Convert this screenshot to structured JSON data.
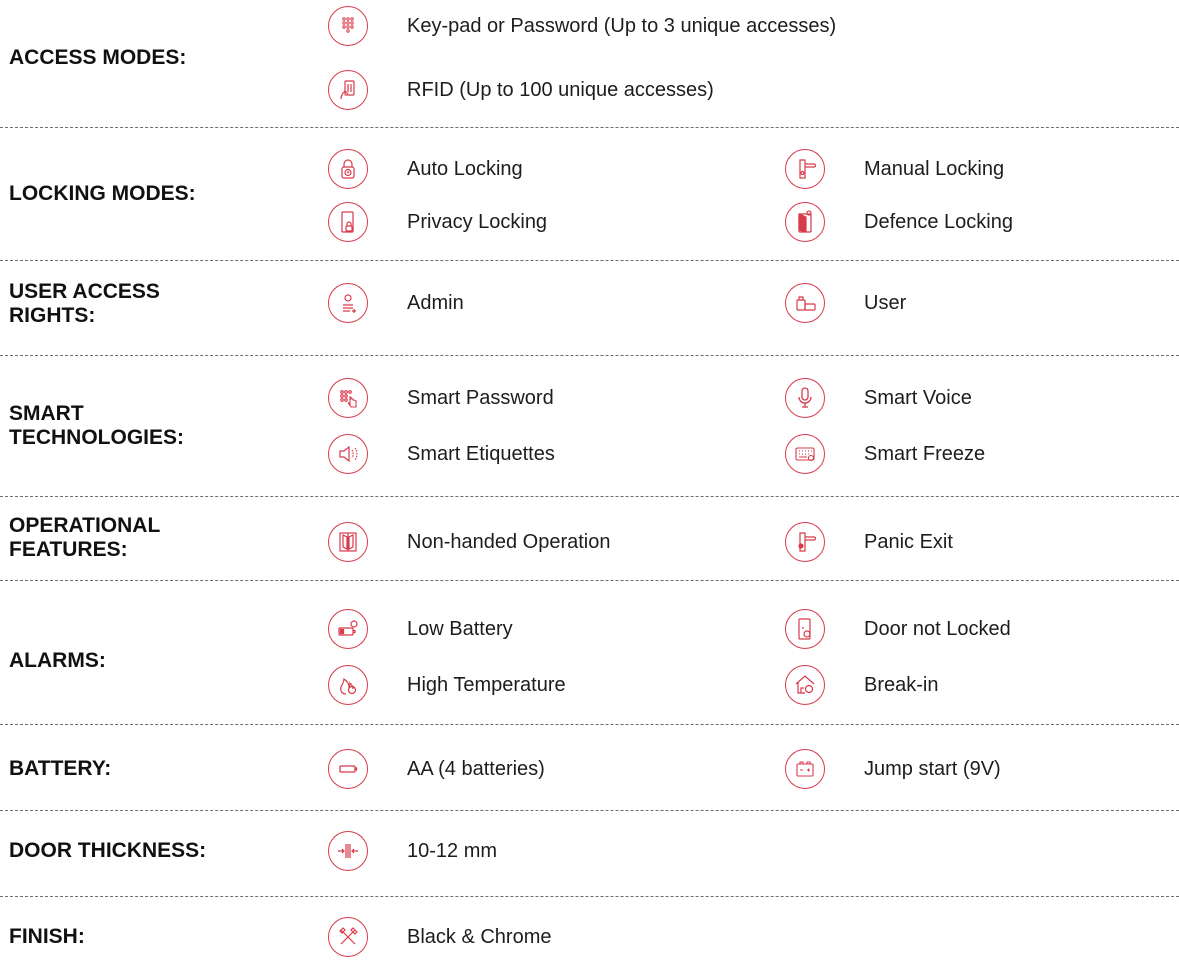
{
  "accent_color": "#d83a4a",
  "sections": [
    {
      "title_lines": [
        "ACCESS MODES:"
      ],
      "items": [
        {
          "icon": "keypad-icon",
          "text": "Key-pad or Password (Up to 3 unique accesses)"
        },
        {
          "icon": "rfid-card-icon",
          "text": "RFID (Up to 100 unique accesses)"
        }
      ]
    },
    {
      "title_lines": [
        "LOCKING MODES:"
      ],
      "items": [
        {
          "icon": "auto-lock-icon",
          "text": "Auto Locking"
        },
        {
          "icon": "door-handle-icon",
          "text": "Manual Locking"
        },
        {
          "icon": "privacy-lock-icon",
          "text": "Privacy Locking"
        },
        {
          "icon": "defence-lock-icon",
          "text": "Defence Locking"
        }
      ]
    },
    {
      "title_lines": [
        "USER ACCESS",
        "RIGHTS:"
      ],
      "items": [
        {
          "icon": "admin-icon",
          "text": "Admin"
        },
        {
          "icon": "user-key-icon",
          "text": "User"
        }
      ]
    },
    {
      "title_lines": [
        "SMART",
        "TECHNOLOGIES:"
      ],
      "items": [
        {
          "icon": "smart-password-icon",
          "text": "Smart Password"
        },
        {
          "icon": "microphone-icon",
          "text": "Smart Voice"
        },
        {
          "icon": "speaker-icon",
          "text": "Smart Etiquettes"
        },
        {
          "icon": "keyboard-freeze-icon",
          "text": "Smart Freeze"
        }
      ]
    },
    {
      "title_lines": [
        "OPERATIONAL",
        "FEATURES:"
      ],
      "items": [
        {
          "icon": "double-door-icon",
          "text": "Non-handed Operation"
        },
        {
          "icon": "panic-handle-icon",
          "text": "Panic Exit"
        }
      ]
    },
    {
      "title_lines": [
        "ALARMS:"
      ],
      "items": [
        {
          "icon": "low-battery-alarm-icon",
          "text": "Low Battery"
        },
        {
          "icon": "door-alarm-icon",
          "text": "Door not Locked"
        },
        {
          "icon": "fire-alarm-icon",
          "text": "High Temperature"
        },
        {
          "icon": "house-alarm-icon",
          "text": "Break-in"
        }
      ]
    },
    {
      "title_lines": [
        "BATTERY:"
      ],
      "items": [
        {
          "icon": "battery-icon",
          "text": "AA (4 batteries)"
        },
        {
          "icon": "car-battery-icon",
          "text": "Jump start (9V)"
        }
      ]
    },
    {
      "title_lines": [
        "DOOR THICKNESS:"
      ],
      "items": [
        {
          "icon": "thickness-icon",
          "text": "10-12 mm"
        }
      ]
    },
    {
      "title_lines": [
        "FINISH:"
      ],
      "items": [
        {
          "icon": "tools-icon",
          "text": "Black & Chrome"
        }
      ]
    }
  ]
}
